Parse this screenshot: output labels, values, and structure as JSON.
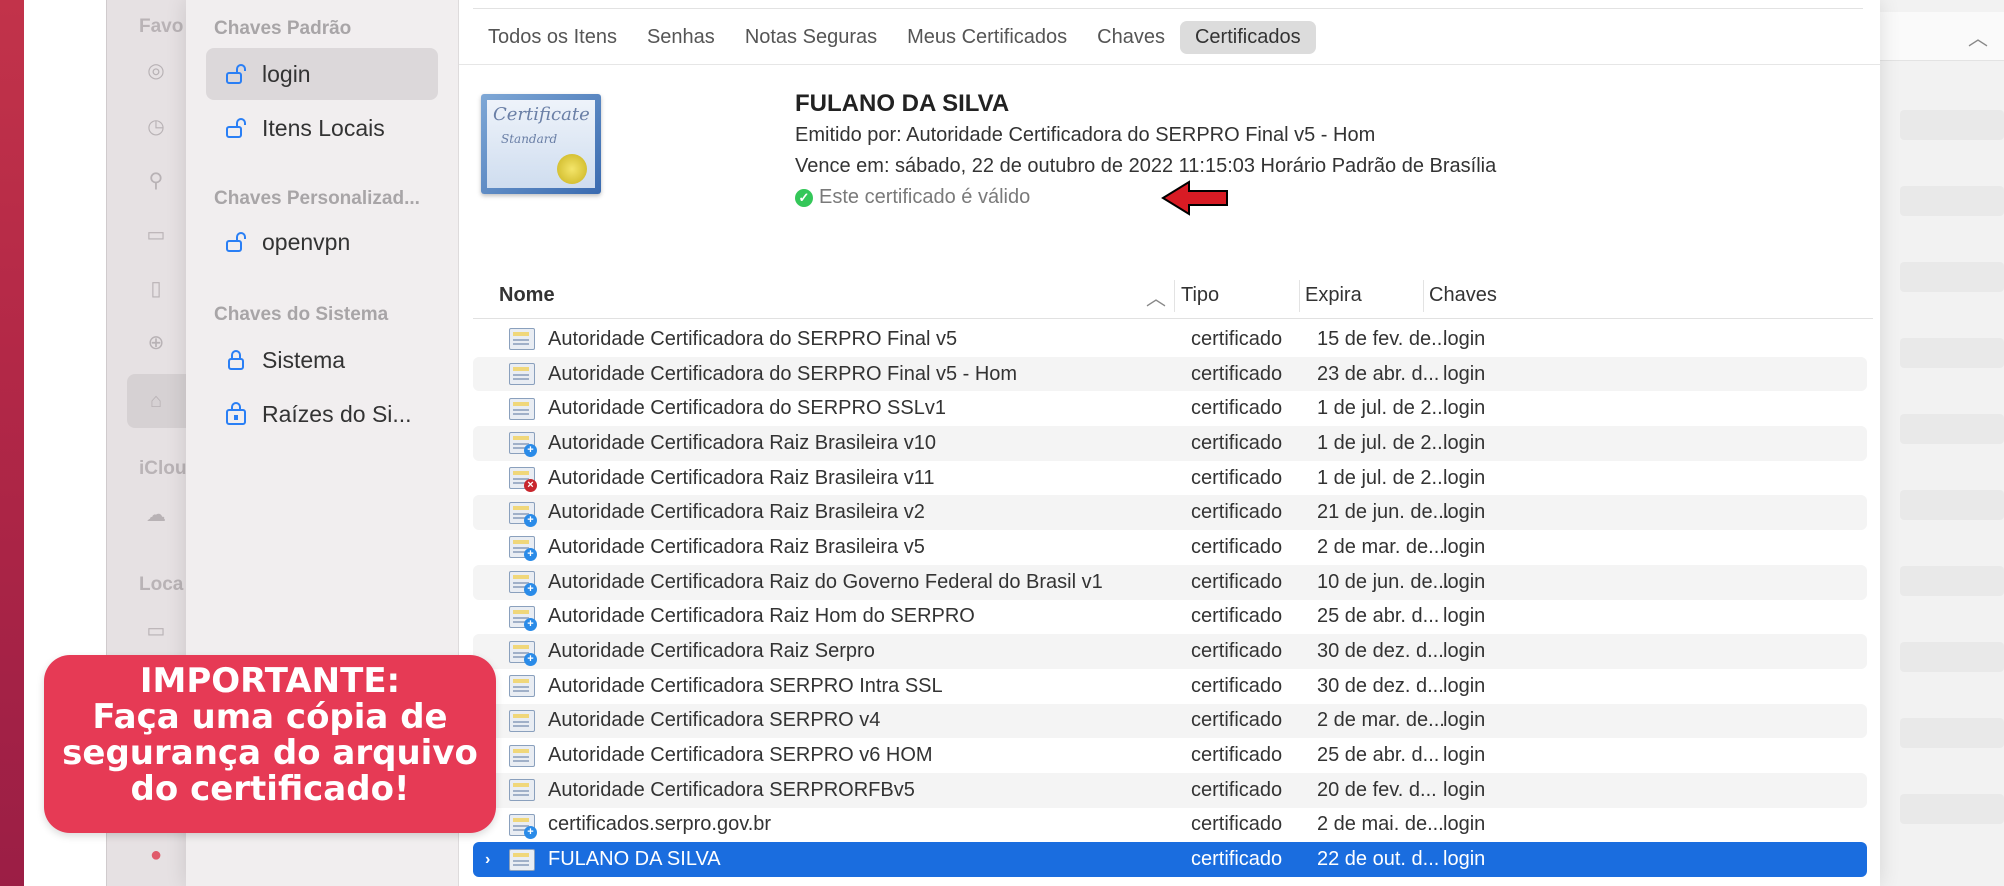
{
  "sidebar": {
    "sections": [
      {
        "header": "Chaves Padrão",
        "items": [
          "login",
          "Itens Locais"
        ]
      },
      {
        "header": "Chaves Personalizad...",
        "items": [
          "openvpn"
        ]
      },
      {
        "header": "Chaves do Sistema",
        "items": [
          "Sistema",
          "Raízes do Si..."
        ]
      }
    ]
  },
  "finder": {
    "labels": [
      "Favo",
      "iClou",
      "Loca"
    ]
  },
  "tabs": [
    "Todos os Itens",
    "Senhas",
    "Notas Seguras",
    "Meus Certificados",
    "Chaves",
    "Certificados"
  ],
  "active_tab": "Certificados",
  "certificate": {
    "name": "FULANO DA SILVA",
    "issued_by": "Emitido por: Autoridade Certificadora do SERPRO Final v5 - Hom",
    "expires": "Vence em: sábado, 22 de outubro de 2022 11:15:03 Horário Padrão de Brasília",
    "status": "Este certificado é válido",
    "icon_text_1": "Certificate",
    "icon_text_2": "Standard"
  },
  "table": {
    "columns": [
      "Nome",
      "Tipo",
      "Expira",
      "Chaves"
    ],
    "rows": [
      {
        "name": "Autoridade Certificadora do SERPRO Final v5",
        "tipo": "certificado",
        "expira": "15 de fev. de...",
        "chaves": "login",
        "icon": "cert"
      },
      {
        "name": "Autoridade Certificadora do SERPRO Final v5 - Hom",
        "tipo": "certificado",
        "expira": "23 de abr. d...",
        "chaves": "login",
        "icon": "cert"
      },
      {
        "name": "Autoridade Certificadora do SERPRO SSLv1",
        "tipo": "certificado",
        "expira": "1 de jul. de 2...",
        "chaves": "login",
        "icon": "cert"
      },
      {
        "name": "Autoridade Certificadora Raiz Brasileira v10",
        "tipo": "certificado",
        "expira": "1 de jul. de 2...",
        "chaves": "login",
        "icon": "cert-plus"
      },
      {
        "name": "Autoridade Certificadora Raiz Brasileira v11",
        "tipo": "certificado",
        "expira": "1 de jul. de 2...",
        "chaves": "login",
        "icon": "cert-x"
      },
      {
        "name": "Autoridade Certificadora Raiz Brasileira v2",
        "tipo": "certificado",
        "expira": "21 de jun. de...",
        "chaves": "login",
        "icon": "cert-plus"
      },
      {
        "name": "Autoridade Certificadora Raiz Brasileira v5",
        "tipo": "certificado",
        "expira": "2 de mar. de...",
        "chaves": "login",
        "icon": "cert-plus"
      },
      {
        "name": "Autoridade Certificadora Raiz do Governo Federal do Brasil v1",
        "tipo": "certificado",
        "expira": "10 de jun. de...",
        "chaves": "login",
        "icon": "cert-plus"
      },
      {
        "name": "Autoridade Certificadora Raiz Hom do SERPRO",
        "tipo": "certificado",
        "expira": "25 de abr. d...",
        "chaves": "login",
        "icon": "cert-plus"
      },
      {
        "name": "Autoridade Certificadora Raiz Serpro",
        "tipo": "certificado",
        "expira": "30 de dez. d...",
        "chaves": "login",
        "icon": "cert-plus"
      },
      {
        "name": "Autoridade Certificadora SERPRO Intra SSL",
        "tipo": "certificado",
        "expira": "30 de dez. d...",
        "chaves": "login",
        "icon": "cert"
      },
      {
        "name": "Autoridade Certificadora SERPRO v4",
        "tipo": "certificado",
        "expira": "2 de mar. de...",
        "chaves": "login",
        "icon": "cert"
      },
      {
        "name": "Autoridade Certificadora SERPRO v6 HOM",
        "tipo": "certificado",
        "expira": "25 de abr. d...",
        "chaves": "login",
        "icon": "cert"
      },
      {
        "name": "Autoridade Certificadora SERPRORFBv5",
        "tipo": "certificado",
        "expira": "20 de fev. d...",
        "chaves": "login",
        "icon": "cert"
      },
      {
        "name": "certificados.serpro.gov.br",
        "tipo": "certificado",
        "expira": "2 de mai. de...",
        "chaves": "login",
        "icon": "cert-plus"
      },
      {
        "name": "FULANO DA SILVA",
        "tipo": "certificado",
        "expira": "22 de out. d...",
        "chaves": "login",
        "icon": "cert",
        "selected": true
      }
    ]
  },
  "callout": {
    "lines": [
      "IMPORTANTE:",
      "Faça uma cópia de",
      "segurança do arquivo",
      "do certificado!"
    ]
  },
  "colors": {
    "accent": "#1a6ddf",
    "callout": "#e63a55",
    "valid": "#34c759",
    "arrow": "#d81b24"
  }
}
